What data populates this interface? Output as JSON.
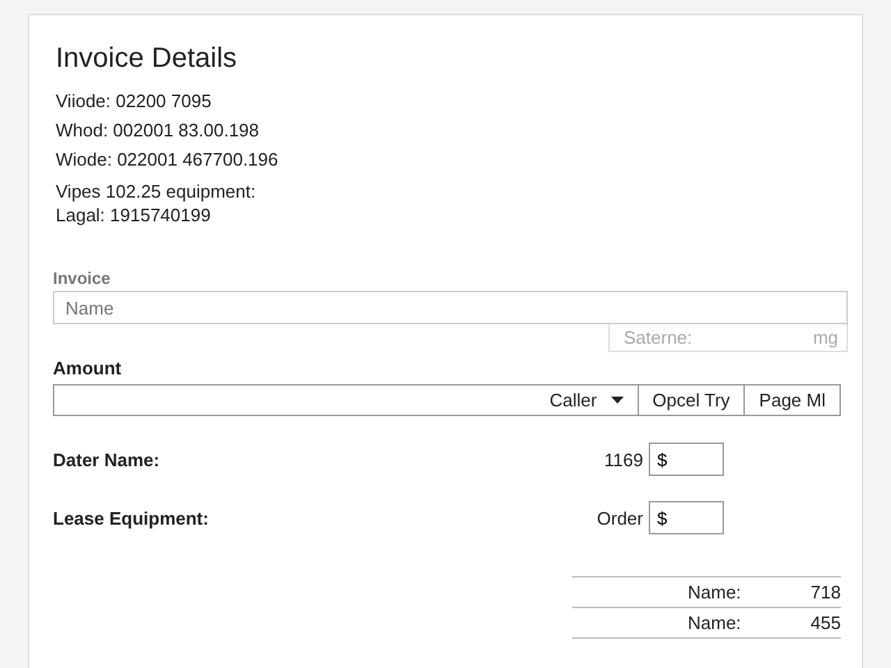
{
  "title": "Invoice Details",
  "details": [
    "Viiode: 02200 7095",
    "Whod: 002001 83.00.198",
    "Wiode: 022001 467700.196",
    "Vipes 102.25 equipment:",
    "Lagal: 1915740199"
  ],
  "invoice": {
    "label": "Invoice",
    "placeholder": "Name",
    "sub_field": {
      "label": "Saterne:",
      "unit": "mg"
    }
  },
  "amount": {
    "label": "Amount",
    "dropdown": "Caller",
    "buttons": [
      "Opcel Try",
      "Page Ml"
    ]
  },
  "fields": [
    {
      "label": "Dater Name:",
      "prefix": "1169",
      "value": "$"
    },
    {
      "label": "Lease Equipment:",
      "prefix": "Order",
      "value": "$"
    }
  ],
  "summary": [
    {
      "label": "Name:",
      "value": "718"
    },
    {
      "label": "Name:",
      "value": "455"
    }
  ]
}
